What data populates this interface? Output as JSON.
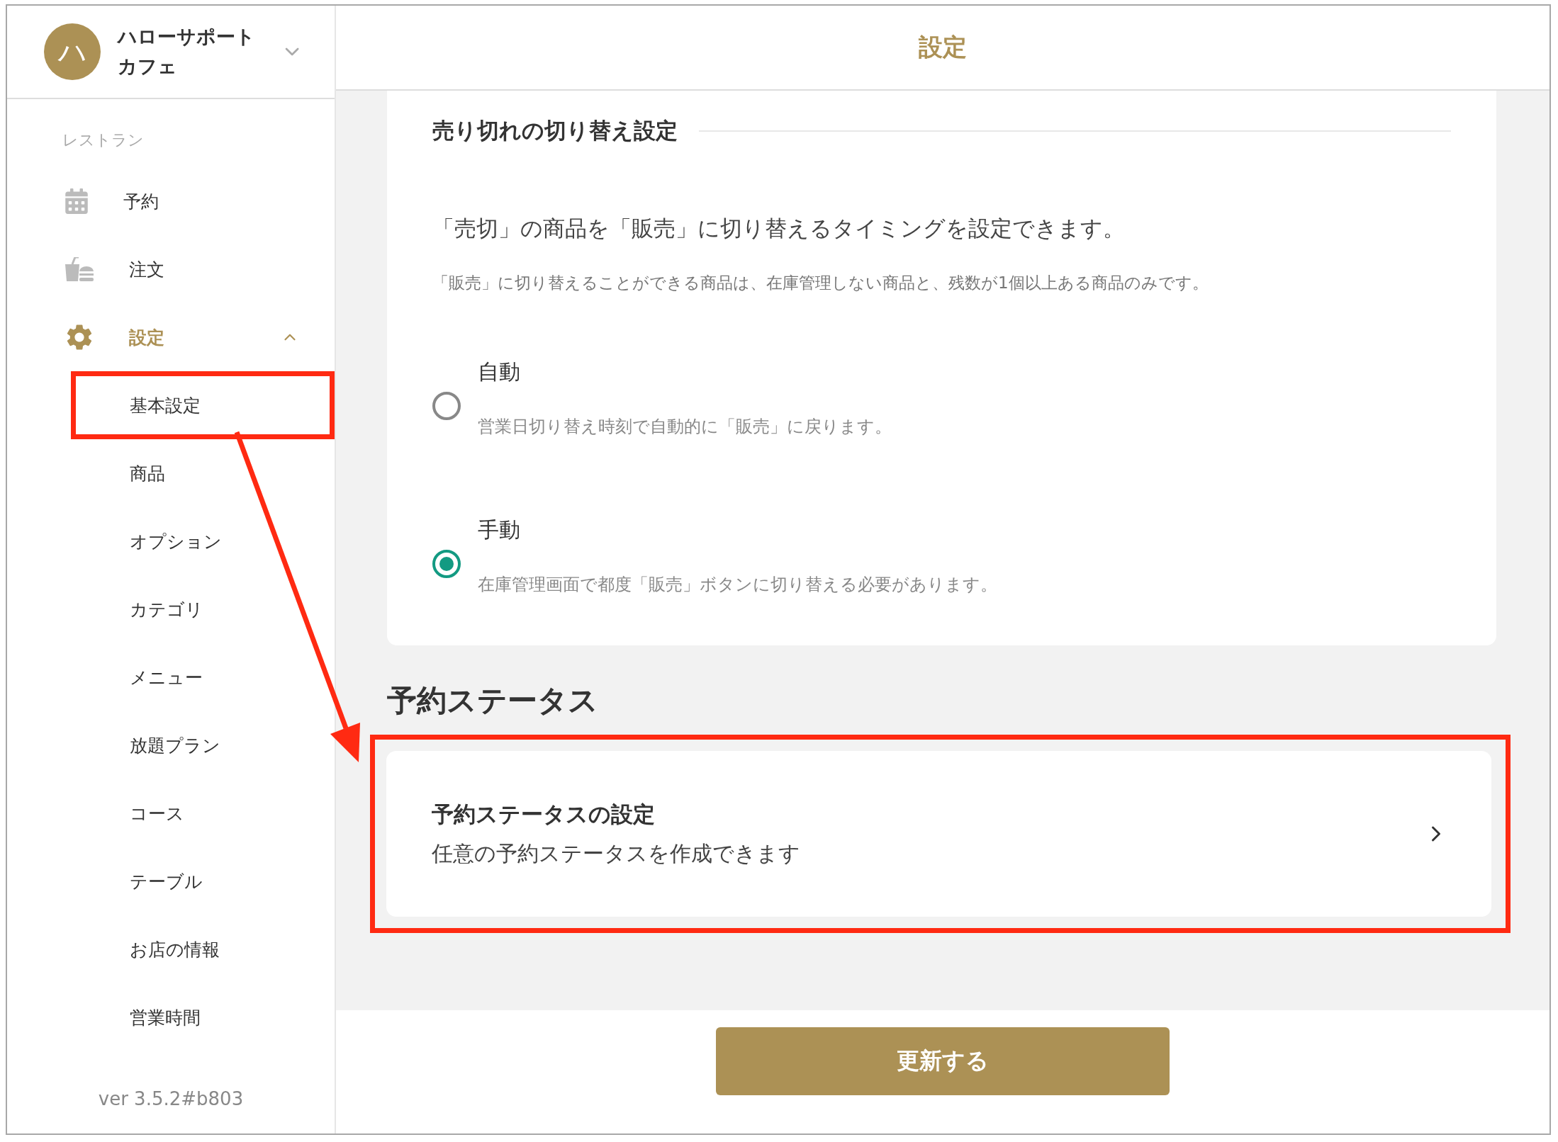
{
  "account": {
    "initial": "ハ",
    "name": "ハローサポートカフェ"
  },
  "sidebar": {
    "section": "レストラン",
    "items": [
      {
        "kind": "calendar",
        "label": "予約",
        "selected": false
      },
      {
        "kind": "food",
        "label": "注文",
        "selected": false
      },
      {
        "kind": "gear",
        "label": "設定",
        "selected": true,
        "expanded": true,
        "children": [
          {
            "label": "基本設定",
            "highlighted": true
          },
          {
            "label": "商品",
            "highlighted": false
          },
          {
            "label": "オプション",
            "highlighted": false
          },
          {
            "label": "カテゴリ",
            "highlighted": false
          },
          {
            "label": "メニュー",
            "highlighted": false
          },
          {
            "label": "放題プラン",
            "highlighted": false
          },
          {
            "label": "コース",
            "highlighted": false
          },
          {
            "label": "テーブル",
            "highlighted": false
          },
          {
            "label": "お店の情報",
            "highlighted": false
          },
          {
            "label": "営業時間",
            "highlighted": false
          }
        ]
      }
    ],
    "version": "ver 3.5.2#b803"
  },
  "header": {
    "title": "設定"
  },
  "soldout": {
    "title": "売り切れの切り替え設定",
    "description": "「売切」の商品を「販売」に切り替えるタイミングを設定できます。",
    "note": "「販売」に切り替えることができる商品は、在庫管理しない商品と、残数が1個以上ある商品のみです。",
    "options": [
      {
        "label": "自動",
        "description": "営業日切り替え時刻で自動的に「販売」に戻ります。",
        "selected": false
      },
      {
        "label": "手動",
        "description": "在庫管理画面で都度「販売」ボタンに切り替える必要があります。",
        "selected": true
      }
    ]
  },
  "reservation_status": {
    "heading": "予約ステータス",
    "card": {
      "title": "予約ステータスの設定",
      "subtitle": "任意の予約ステータスを作成できます",
      "highlighted": true
    }
  },
  "update_button": "更新する"
}
